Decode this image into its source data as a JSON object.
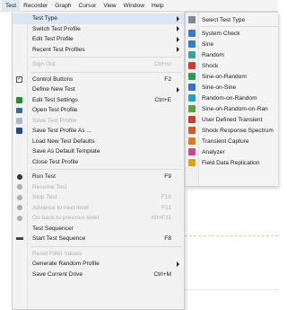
{
  "menubar": {
    "items": [
      "Test",
      "Recorder",
      "Graph",
      "Cursor",
      "View",
      "Window",
      "Help"
    ]
  },
  "menu": {
    "items": [
      {
        "label": "Test Type",
        "shortcut": "",
        "submenu": true,
        "disabled": false,
        "icon": "",
        "highlight": true
      },
      {
        "label": "Switch Test Profile",
        "shortcut": "",
        "submenu": true,
        "disabled": false,
        "icon": ""
      },
      {
        "label": "Edit Test Profile",
        "shortcut": "",
        "submenu": true,
        "disabled": false,
        "icon": ""
      },
      {
        "label": "Recent Test Profiles",
        "shortcut": "",
        "submenu": true,
        "disabled": false,
        "icon": ""
      },
      {
        "sep": true
      },
      {
        "label": "Sign Out",
        "shortcut": "Ctrl+U",
        "submenu": false,
        "disabled": true,
        "icon": ""
      },
      {
        "sep": true
      },
      {
        "label": "Control Buttons",
        "shortcut": "F2",
        "submenu": false,
        "disabled": false,
        "icon": "check-icon"
      },
      {
        "label": "Define New Test",
        "shortcut": "",
        "submenu": true,
        "disabled": false,
        "icon": ""
      },
      {
        "label": "Edit Test Settings",
        "shortcut": "Ctrl+E",
        "submenu": false,
        "disabled": false,
        "icon": "settings-icon"
      },
      {
        "label": "Open Test Profile",
        "shortcut": "",
        "submenu": false,
        "disabled": false,
        "icon": "open-icon"
      },
      {
        "label": "Save Test Profile",
        "shortcut": "",
        "submenu": false,
        "disabled": true,
        "icon": "save-icon"
      },
      {
        "label": "Save Test Profile As ...",
        "shortcut": "",
        "submenu": false,
        "disabled": false,
        "icon": "save-as-icon"
      },
      {
        "label": "Load New Test Defaults",
        "shortcut": "",
        "submenu": false,
        "disabled": false,
        "icon": ""
      },
      {
        "label": "Save As Default Template",
        "shortcut": "",
        "submenu": false,
        "disabled": false,
        "icon": ""
      },
      {
        "label": "Close Test Profile",
        "shortcut": "",
        "submenu": false,
        "disabled": false,
        "icon": ""
      },
      {
        "sep": true
      },
      {
        "label": "Run Test",
        "shortcut": "F9",
        "submenu": false,
        "disabled": false,
        "icon": "run-icon"
      },
      {
        "label": "Resume Test",
        "shortcut": "",
        "submenu": false,
        "disabled": true,
        "icon": "resume-icon"
      },
      {
        "label": "Stop Test",
        "shortcut": "F10",
        "submenu": false,
        "disabled": true,
        "icon": "stop-icon"
      },
      {
        "label": "Advance to next level",
        "shortcut": "F11",
        "submenu": false,
        "disabled": true,
        "icon": "advance-icon"
      },
      {
        "label": "Go back to previous level",
        "shortcut": "Alt+F11",
        "submenu": false,
        "disabled": true,
        "icon": "back-icon"
      },
      {
        "label": "Test Sequencer",
        "shortcut": "",
        "submenu": false,
        "disabled": false,
        "icon": ""
      },
      {
        "label": "Start Test Sequence",
        "shortcut": "F8",
        "submenu": false,
        "disabled": false,
        "icon": "sequence-icon"
      },
      {
        "sep": true
      },
      {
        "label": "Reset Filter Values",
        "shortcut": "",
        "submenu": false,
        "disabled": true,
        "icon": ""
      },
      {
        "label": "Generate Random Profile",
        "shortcut": "",
        "submenu": true,
        "disabled": false,
        "icon": ""
      },
      {
        "label": "Save Current Drive",
        "shortcut": "Ctrl+M",
        "submenu": false,
        "disabled": false,
        "icon": ""
      }
    ]
  },
  "submenu": {
    "items": [
      {
        "label": "Select Test Type",
        "color": "#7a8a9a"
      },
      {
        "sep": true
      },
      {
        "label": "System Check",
        "color": "#3a78c8"
      },
      {
        "label": "Sine",
        "color": "#2f7fd0"
      },
      {
        "label": "Random",
        "color": "#3aa0a0"
      },
      {
        "label": "Shock",
        "color": "#d23a2a"
      },
      {
        "label": "Sine-on-Random",
        "color": "#2a9a5a"
      },
      {
        "label": "Sine-on-Sine",
        "color": "#3a6fd0"
      },
      {
        "label": "Random-on-Random",
        "color": "#2aa0c0"
      },
      {
        "label": "Sine-on-Random-on-Ran",
        "color": "#5aa040"
      },
      {
        "label": "User Defined Transient",
        "color": "#c8402a"
      },
      {
        "label": "Shock Response Spectrum",
        "color": "#d05a2a"
      },
      {
        "label": "Transient Capture",
        "color": "#e07a20"
      },
      {
        "label": "Analyzer",
        "color": "#c84a8a"
      },
      {
        "label": "Field Data Replication",
        "color": "#e0a020"
      }
    ]
  }
}
